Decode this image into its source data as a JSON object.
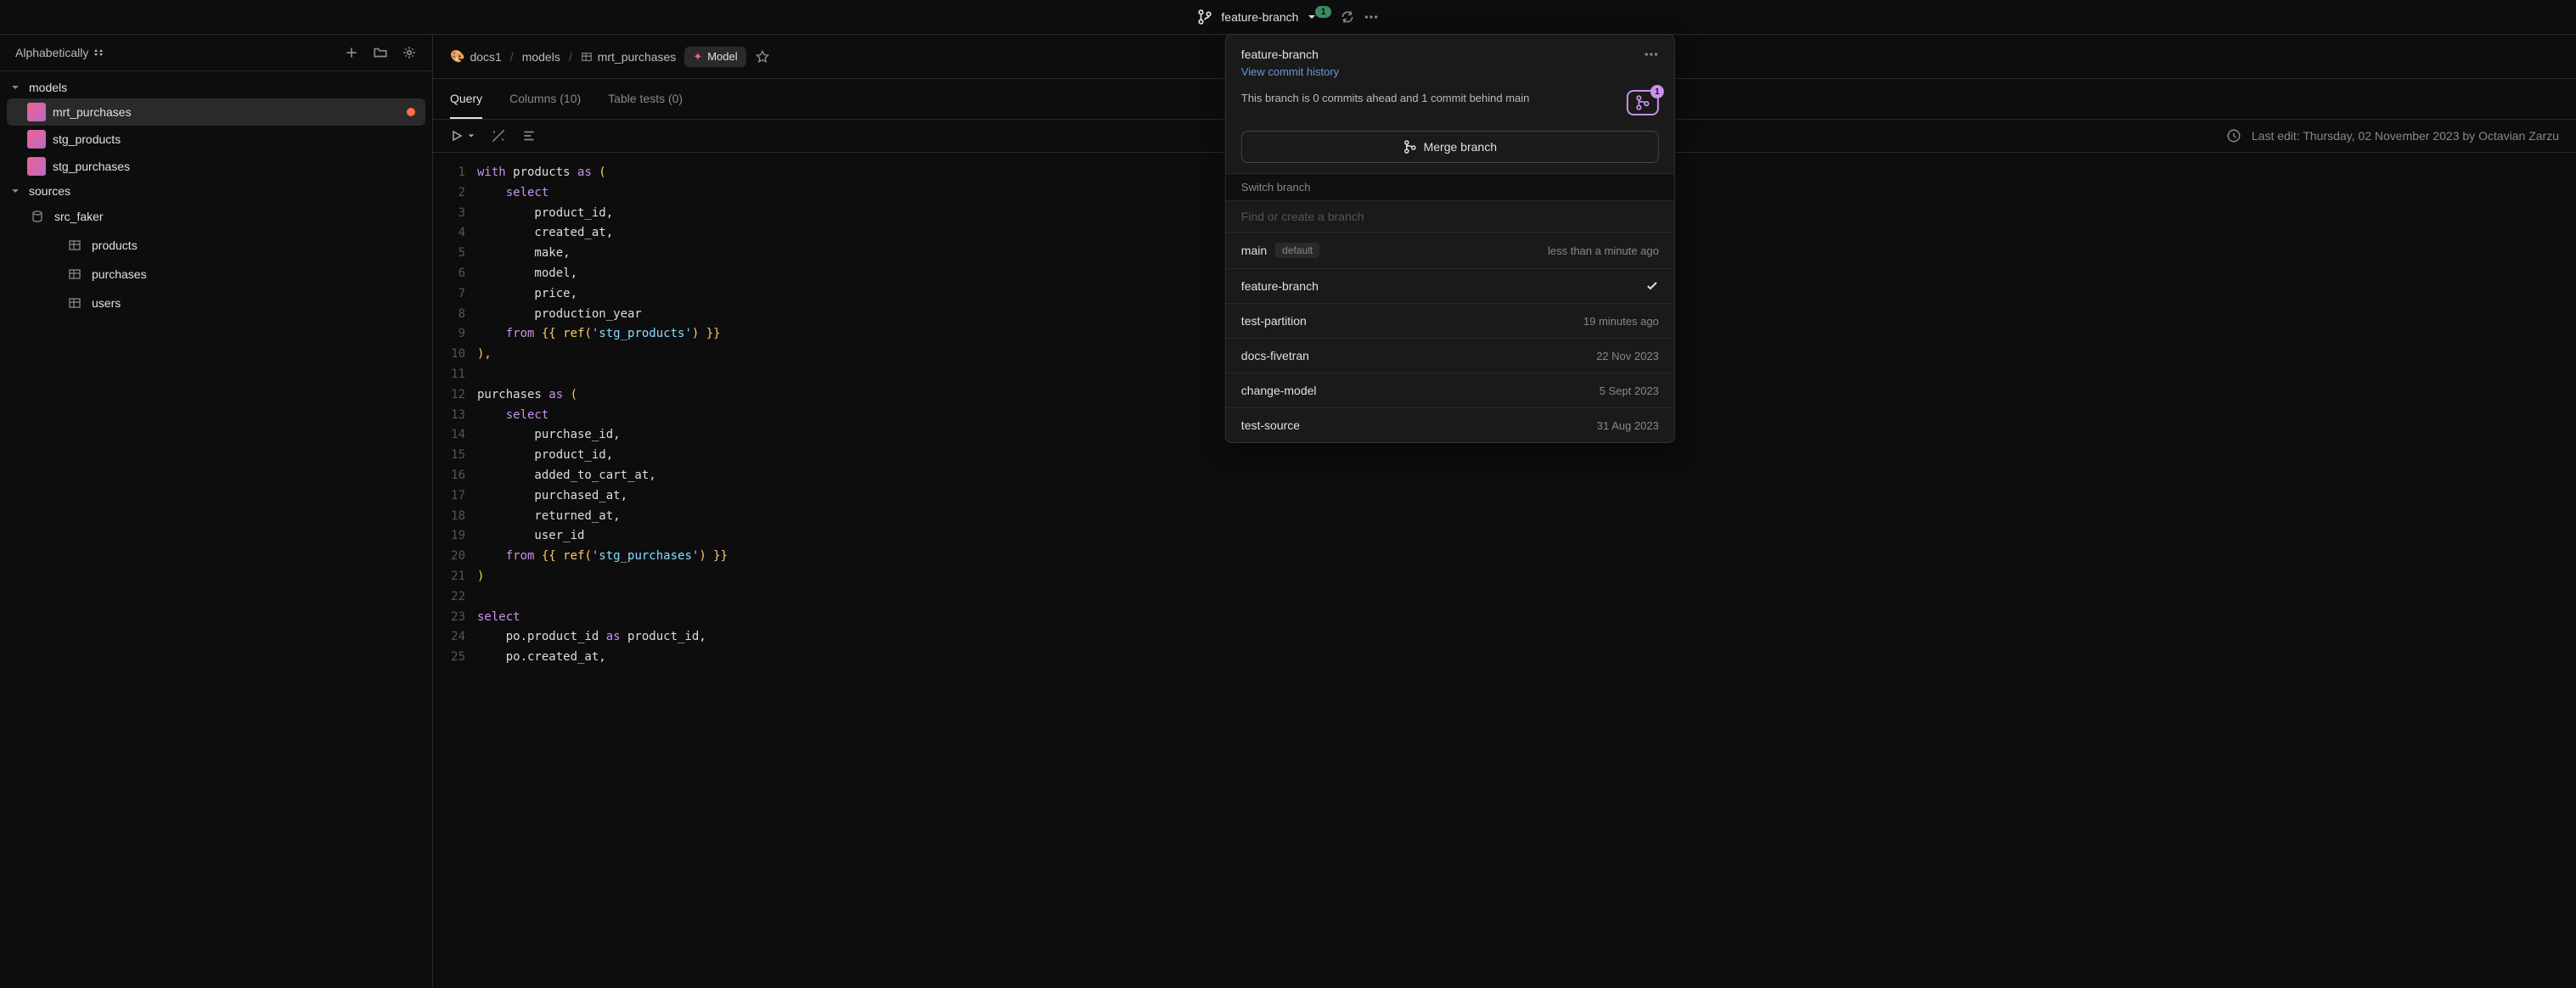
{
  "topbar": {
    "branch_name": "feature-branch",
    "badge": "1"
  },
  "sidebar": {
    "sort_label": "Alphabetically",
    "tree": {
      "models": {
        "label": "models",
        "items": [
          {
            "label": "mrt_purchases",
            "active": true,
            "dot": true
          },
          {
            "label": "stg_products"
          },
          {
            "label": "stg_purchases"
          }
        ]
      },
      "sources": {
        "label": "sources",
        "items": [
          {
            "label": "src_faker",
            "children": [
              {
                "label": "products"
              },
              {
                "label": "purchases"
              },
              {
                "label": "users"
              }
            ]
          }
        ]
      }
    }
  },
  "breadcrumb": {
    "repo": "docs1",
    "folder": "models",
    "file": "mrt_purchases",
    "model_badge": "Model"
  },
  "tabs": {
    "query": "Query",
    "columns": "Columns (10)",
    "tests": "Table tests (0)"
  },
  "toolbar": {
    "last_edit": "Last edit: Thursday, 02 November 2023 by Octavian Zarzu"
  },
  "code": {
    "lines": [
      {
        "n": 1,
        "tokens": [
          {
            "t": "with",
            "c": "keyword"
          },
          {
            "t": " products ",
            "c": "ident"
          },
          {
            "t": "as",
            "c": "keyword"
          },
          {
            "t": " (",
            "c": "brace"
          }
        ]
      },
      {
        "n": 2,
        "tokens": [
          {
            "t": "    ",
            "c": ""
          },
          {
            "t": "select",
            "c": "keyword"
          }
        ]
      },
      {
        "n": 3,
        "tokens": [
          {
            "t": "        product_id,",
            "c": "ident"
          }
        ]
      },
      {
        "n": 4,
        "tokens": [
          {
            "t": "        created_at,",
            "c": "ident"
          }
        ]
      },
      {
        "n": 5,
        "tokens": [
          {
            "t": "        make,",
            "c": "ident"
          }
        ]
      },
      {
        "n": 6,
        "tokens": [
          {
            "t": "        model,",
            "c": "ident"
          }
        ]
      },
      {
        "n": 7,
        "tokens": [
          {
            "t": "        price,",
            "c": "ident"
          }
        ]
      },
      {
        "n": 8,
        "tokens": [
          {
            "t": "        production_year",
            "c": "ident"
          }
        ]
      },
      {
        "n": 9,
        "tokens": [
          {
            "t": "    ",
            "c": ""
          },
          {
            "t": "from",
            "c": "keyword"
          },
          {
            "t": " {{ ref(",
            "c": "brace"
          },
          {
            "t": "'stg_products'",
            "c": "string"
          },
          {
            "t": ") }}",
            "c": "brace"
          }
        ]
      },
      {
        "n": 10,
        "tokens": [
          {
            "t": "),",
            "c": "brace"
          }
        ]
      },
      {
        "n": 11,
        "tokens": [
          {
            "t": "",
            "c": ""
          }
        ]
      },
      {
        "n": 12,
        "tokens": [
          {
            "t": "purchases ",
            "c": "ident"
          },
          {
            "t": "as",
            "c": "keyword"
          },
          {
            "t": " (",
            "c": "brace"
          }
        ]
      },
      {
        "n": 13,
        "tokens": [
          {
            "t": "    ",
            "c": ""
          },
          {
            "t": "select",
            "c": "keyword"
          }
        ]
      },
      {
        "n": 14,
        "tokens": [
          {
            "t": "        purchase_id,",
            "c": "ident"
          }
        ]
      },
      {
        "n": 15,
        "tokens": [
          {
            "t": "        product_id,",
            "c": "ident"
          }
        ]
      },
      {
        "n": 16,
        "tokens": [
          {
            "t": "        added_to_cart_at,",
            "c": "ident"
          }
        ]
      },
      {
        "n": 17,
        "tokens": [
          {
            "t": "        purchased_at,",
            "c": "ident"
          }
        ]
      },
      {
        "n": 18,
        "tokens": [
          {
            "t": "        returned_at,",
            "c": "ident"
          }
        ]
      },
      {
        "n": 19,
        "tokens": [
          {
            "t": "        user_id",
            "c": "ident"
          }
        ]
      },
      {
        "n": 20,
        "tokens": [
          {
            "t": "    ",
            "c": ""
          },
          {
            "t": "from",
            "c": "keyword"
          },
          {
            "t": " {{ ref(",
            "c": "brace"
          },
          {
            "t": "'stg_purchases'",
            "c": "string"
          },
          {
            "t": ") }}",
            "c": "brace"
          }
        ]
      },
      {
        "n": 21,
        "tokens": [
          {
            "t": ")",
            "c": "brace"
          }
        ]
      },
      {
        "n": 22,
        "tokens": [
          {
            "t": "",
            "c": ""
          }
        ]
      },
      {
        "n": 23,
        "tokens": [
          {
            "t": "select",
            "c": "keyword"
          }
        ]
      },
      {
        "n": 24,
        "tokens": [
          {
            "t": "    po.product_id ",
            "c": "ident"
          },
          {
            "t": "as",
            "c": "keyword"
          },
          {
            "t": " product_id,",
            "c": "ident"
          }
        ]
      },
      {
        "n": 25,
        "tokens": [
          {
            "t": "    po.created_at,",
            "c": "ident"
          }
        ]
      }
    ]
  },
  "panel": {
    "title": "feature-branch",
    "view_history": "View commit history",
    "message": "This branch is 0 commits ahead and 1 commit behind main",
    "merge_badge": "1",
    "merge_btn": "Merge branch",
    "switch_header": "Switch branch",
    "search_placeholder": "Find or create a branch",
    "branches": [
      {
        "name": "main",
        "default_label": "default",
        "meta": "less than a minute ago",
        "checked": false
      },
      {
        "name": "feature-branch",
        "meta": "",
        "checked": true
      },
      {
        "name": "test-partition",
        "meta": "19 minutes ago"
      },
      {
        "name": "docs-fivetran",
        "meta": "22 Nov 2023"
      },
      {
        "name": "change-model",
        "meta": "5 Sept 2023"
      },
      {
        "name": "test-source",
        "meta": "31 Aug 2023"
      }
    ]
  }
}
